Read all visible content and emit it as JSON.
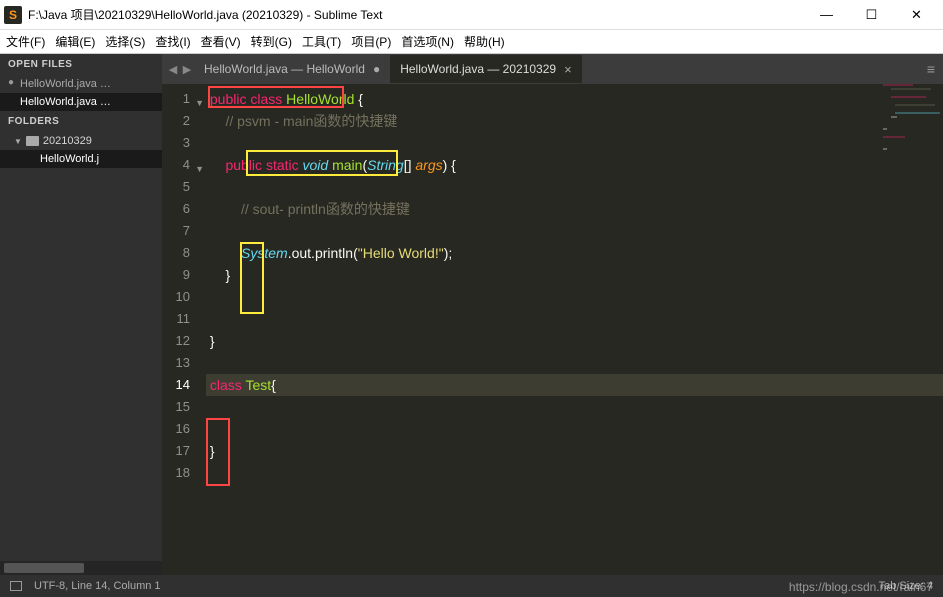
{
  "window": {
    "title": "F:\\Java  项目\\20210329\\HelloWorld.java (20210329) - Sublime Text"
  },
  "menu": {
    "file": "文件(F)",
    "edit": "编辑(E)",
    "select": "选择(S)",
    "find": "查找(I)",
    "view": "查看(V)",
    "goto": "转到(G)",
    "tools": "工具(T)",
    "project": "项目(P)",
    "prefs": "首选项(N)",
    "help": "帮助(H)"
  },
  "sidebar": {
    "open_files_title": "OPEN FILES",
    "open_files": [
      {
        "label": "HelloWorld.java …",
        "dirty": true,
        "selected": false
      },
      {
        "label": "HelloWorld.java …",
        "dirty": false,
        "selected": true
      }
    ],
    "folders_title": "FOLDERS",
    "folder": "20210329",
    "file": "HelloWorld.j"
  },
  "tabs": {
    "inactive": "HelloWorld.java — HelloWorld",
    "active": "HelloWorld.java — 20210329"
  },
  "code": {
    "l1": {
      "kw1": "public",
      "kw2": "class",
      "cls": "HelloWorld",
      "br": " {"
    },
    "l2": {
      "cm": "// psvm - main函数的快捷键"
    },
    "l4": {
      "kw1": "public",
      "kw2": "static",
      "type": "void",
      "fn": "main",
      "p1": "(",
      "ptype": "String",
      "arr": "[] ",
      "var": "args",
      "p2": ") {"
    },
    "l6": {
      "cm": "// sout- println函数的快捷键"
    },
    "l8": {
      "type": "System",
      "dot1": ".out.println(",
      "str": "\"Hello World!\"",
      "end": ");"
    },
    "l9": {
      "br": "}"
    },
    "l12": {
      "br": "}"
    },
    "l14": {
      "kw": "class",
      "cls": "Test",
      "br": "{"
    },
    "l17": {
      "br": "}"
    }
  },
  "status": {
    "left": "UTF-8, Line 14, Column 1",
    "right": "Tab Size: 4",
    "watermark": "https://blog.csdn.net/rain67"
  }
}
